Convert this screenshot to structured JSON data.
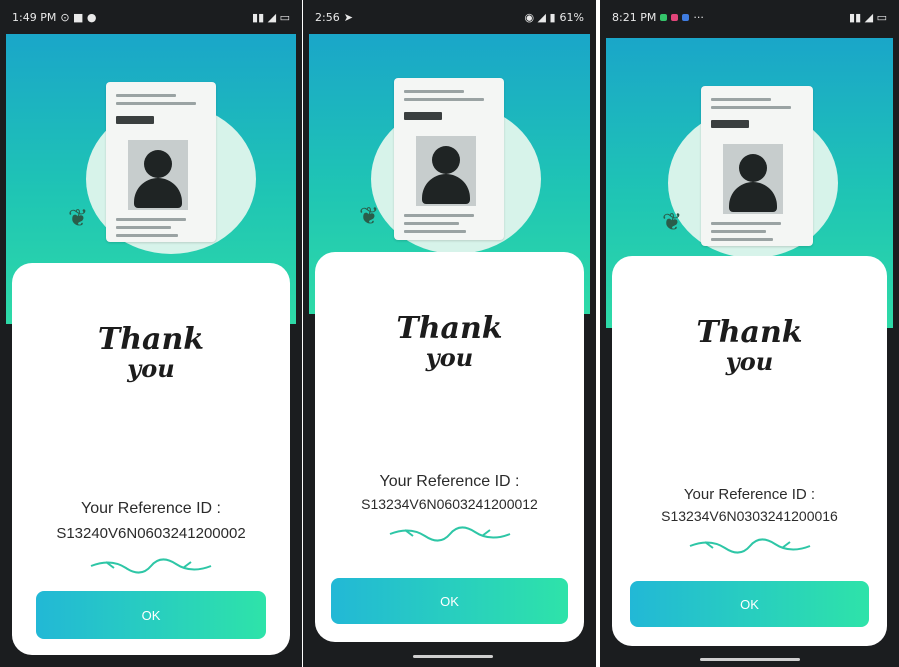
{
  "screens": [
    {
      "status_time": "1:49 PM",
      "thank_line1": "Thank",
      "thank_line2": "you",
      "reference_label": "Your Reference ID :",
      "reference_id": "S13240V6N0603241200002",
      "ok_label": "OK"
    },
    {
      "status_time": "2:56",
      "status_battery": "61%",
      "thank_line1": "Thank",
      "thank_line2": "you",
      "reference_label": "Your Reference ID :",
      "reference_id": "S13234V6N0603241200012",
      "ok_label": "OK"
    },
    {
      "status_time": "8:21 PM",
      "thank_line1": "Thank",
      "thank_line2": "you",
      "reference_label": "Your Reference ID :",
      "reference_id": "S13234V6N0303241200016",
      "ok_label": "OK"
    }
  ],
  "colors": {
    "gradient_top": "#1aa6c9",
    "gradient_bottom": "#2edaa7",
    "button_start": "#22b8d6",
    "button_end": "#2ee3a9"
  }
}
